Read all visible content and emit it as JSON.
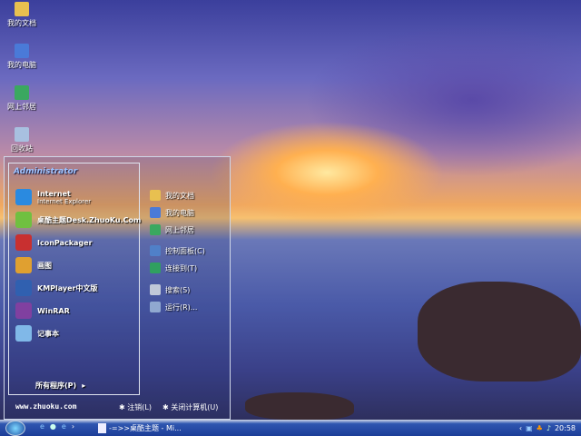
{
  "desktop": {
    "icons": [
      {
        "label": "我的文档",
        "icon": "folder-icon",
        "color": "#e8c050"
      },
      {
        "label": "我的电脑",
        "icon": "computer-icon",
        "color": "#4a7ad8"
      },
      {
        "label": "网上邻居",
        "icon": "network-icon",
        "color": "#3aa860"
      },
      {
        "label": "回收站",
        "icon": "recycle-bin-icon",
        "color": "#a8c0e0"
      }
    ]
  },
  "start_menu": {
    "user": "Administrator",
    "pinned": [
      {
        "label": "Internet",
        "sub": "Internet Explorer",
        "icon": "internet-explorer-icon",
        "color": "#2a8ae0"
      },
      {
        "label": "桌酷主题Desk.ZhuoKu.Com",
        "icon": "theme-icon",
        "color": "#70c040"
      },
      {
        "label": "IconPackager",
        "icon": "iconpackager-icon",
        "color": "#c83030"
      },
      {
        "label": "画图",
        "icon": "paint-icon",
        "color": "#e0a030"
      },
      {
        "label": "KMPlayer中文版",
        "icon": "kmplayer-icon",
        "color": "#3060b0"
      },
      {
        "label": "WinRAR",
        "icon": "winrar-icon",
        "color": "#8040a0"
      },
      {
        "label": "记事本",
        "icon": "notepad-icon",
        "color": "#80b8e8"
      }
    ],
    "all_programs": "所有程序(P)",
    "places": [
      {
        "label": "我的文档",
        "icon": "folder-icon",
        "color": "#e8c050"
      },
      {
        "label": "我的电脑",
        "icon": "computer-icon",
        "color": "#4a7ad8"
      },
      {
        "label": "网上邻居",
        "icon": "network-icon",
        "color": "#3aa860"
      },
      {
        "label": "控制面板(C)",
        "icon": "control-panel-icon",
        "color": "#5080c8"
      },
      {
        "label": "连接到(T)",
        "icon": "connect-icon",
        "color": "#30a060"
      },
      {
        "label": "搜索(S)",
        "icon": "search-icon",
        "color": "#c0c8d8"
      },
      {
        "label": "运行(R)...",
        "icon": "run-icon",
        "color": "#90a8d0"
      }
    ],
    "website": "www.zhuoku.com",
    "logoff": "注销(L)",
    "shutdown": "关闭计算机(U)"
  },
  "taskbar": {
    "quick_launch_separator": "›",
    "task": "-=>>桌酷主题 - Mi...",
    "clock": "20:58"
  }
}
